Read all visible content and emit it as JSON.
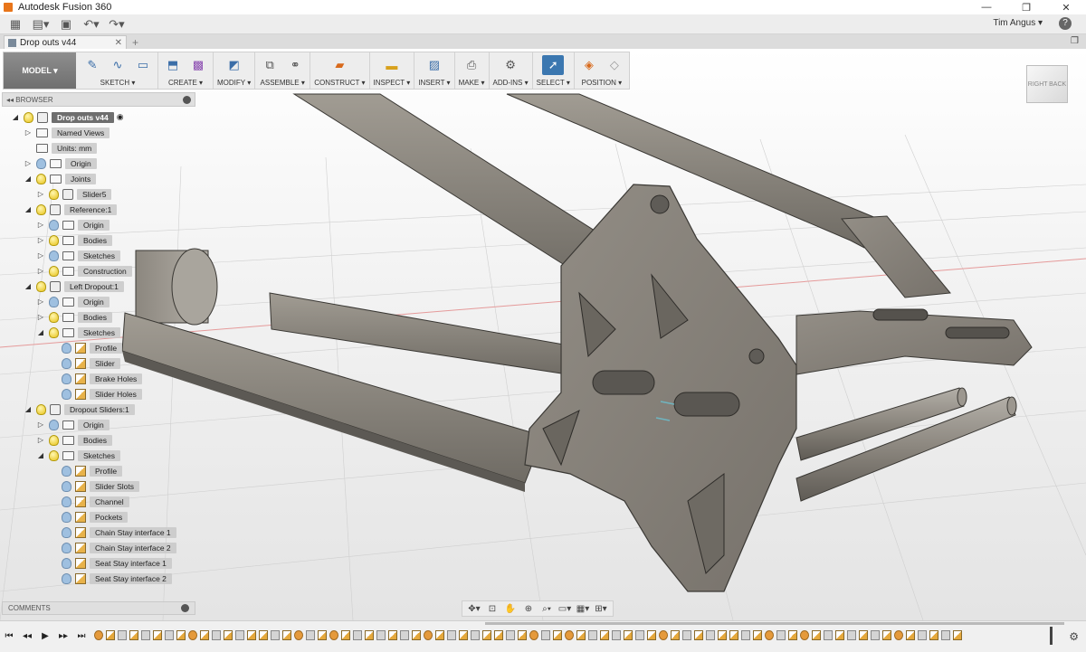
{
  "app": {
    "title": "Autodesk Fusion 360"
  },
  "window": {
    "minimize": "—",
    "restore": "❐",
    "close": "✕"
  },
  "qat": {
    "user": "Tim Angus ▾",
    "help": "?"
  },
  "doc_tab": {
    "label": "Drop outs v44",
    "close": "✕"
  },
  "toolbar": {
    "mode": "MODEL ▾",
    "groups": [
      "SKETCH ▾",
      "CREATE ▾",
      "MODIFY ▾",
      "ASSEMBLE ▾",
      "CONSTRUCT ▾",
      "INSPECT ▾",
      "INSERT ▾",
      "MAKE ▾",
      "ADD-INS ▾",
      "SELECT ▾",
      "POSITION ▾"
    ]
  },
  "viewcube": {
    "right": "RIGHT",
    "back": "BACK"
  },
  "browser": {
    "title": "BROWSER",
    "nodes": [
      "Drop outs v44",
      "Named Views",
      "Units: mm",
      "Origin",
      "Joints",
      "Slider5",
      "Reference:1",
      "Origin",
      "Bodies",
      "Sketches",
      "Construction",
      "Left Dropout:1",
      "Origin",
      "Bodies",
      "Sketches",
      "Profile",
      "Slider",
      "Brake Holes",
      "Slider Holes",
      "Dropout Sliders:1",
      "Origin",
      "Bodies",
      "Sketches",
      "Profile",
      "Slider Slots",
      "Channel",
      "Pockets",
      "Chain Stay interface 1",
      "Chain Stay interface 2",
      "Seat Stay interface 1",
      "Seat Stay interface 2"
    ]
  },
  "comments": {
    "title": "COMMENTS"
  },
  "colors": {
    "accent": "#3b77b0",
    "bulb_on": "#e8c21a",
    "bulb_off": "#9fc0e0",
    "metal": "#8d8880"
  },
  "icons": {
    "qat": [
      "grid-menu-icon",
      "file-icon",
      "save-icon",
      "undo-icon",
      "redo-icon"
    ],
    "navbar": [
      "orbit-icon",
      "look-at-icon",
      "pan-icon",
      "zoom-icon",
      "fit-icon",
      "display-settings-icon",
      "grid-settings-icon",
      "viewports-icon"
    ],
    "timeline": [
      "first-step-icon",
      "previous-step-icon",
      "play-icon",
      "next-step-icon",
      "last-step-icon"
    ]
  }
}
